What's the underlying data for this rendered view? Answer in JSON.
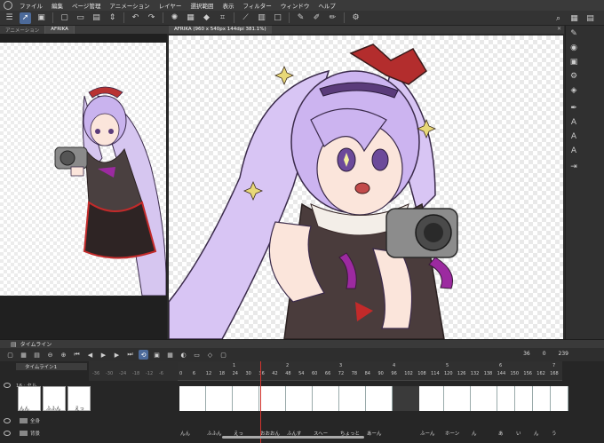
{
  "menu": {
    "items": [
      "ファイル",
      "編集",
      "ページ管理",
      "アニメーション",
      "レイヤー",
      "選択範囲",
      "表示",
      "フィルター",
      "ウィンドウ",
      "ヘルプ"
    ]
  },
  "toolbar": {
    "icons": [
      "menu-icon",
      "select-icon",
      "layers-icon",
      "new-icon",
      "open-icon",
      "save-icon",
      "undo-icon",
      "redo-icon",
      "transform-icon",
      "fill-icon",
      "pen-icon",
      "eraser-icon"
    ]
  },
  "navigator": {
    "tab_animation": "アニメーション",
    "tab_file": "AFRIKA"
  },
  "canvas": {
    "tab_title": "AFRIKA (960 x 540px 144dpi 381.1%)",
    "close_glyph": "✕"
  },
  "timeline": {
    "panel_title": "タイムライン",
    "track_name": "タイムライン1",
    "frame_current": "36",
    "frame_start": "0",
    "frame_end": "239",
    "ruler_left": [
      "-36",
      "-30",
      "-24",
      "-18",
      "-12",
      "-6"
    ],
    "ruler_main": [
      "0",
      "6",
      "12",
      "18",
      "24",
      "30",
      "36",
      "42",
      "48",
      "54",
      "60",
      "66",
      "72",
      "78",
      "84",
      "90",
      "96",
      "102",
      "108",
      "114",
      "120",
      "126",
      "132",
      "138",
      "144",
      "150",
      "156",
      "162",
      "168"
    ],
    "ruler_major": [
      "1",
      "2",
      "3",
      "4",
      "5",
      "6",
      "7"
    ],
    "layers": [
      {
        "name": "16 : セル"
      },
      {
        "name": "全身"
      },
      {
        "name": "背景"
      }
    ],
    "left_cel_labels": [
      "んん",
      "ふふん",
      "えっ"
    ],
    "cel_labels": [
      "んん",
      "ふふん",
      "えっ",
      "おおおん",
      "ふんす",
      "スヘー",
      "ちょっと",
      "あーん",
      "ふーん",
      "ホーン",
      "ん",
      "あ",
      "い",
      "ん",
      "う"
    ]
  },
  "colors": {
    "accent": "#4c6a9a",
    "playhead": "#d2342e"
  }
}
